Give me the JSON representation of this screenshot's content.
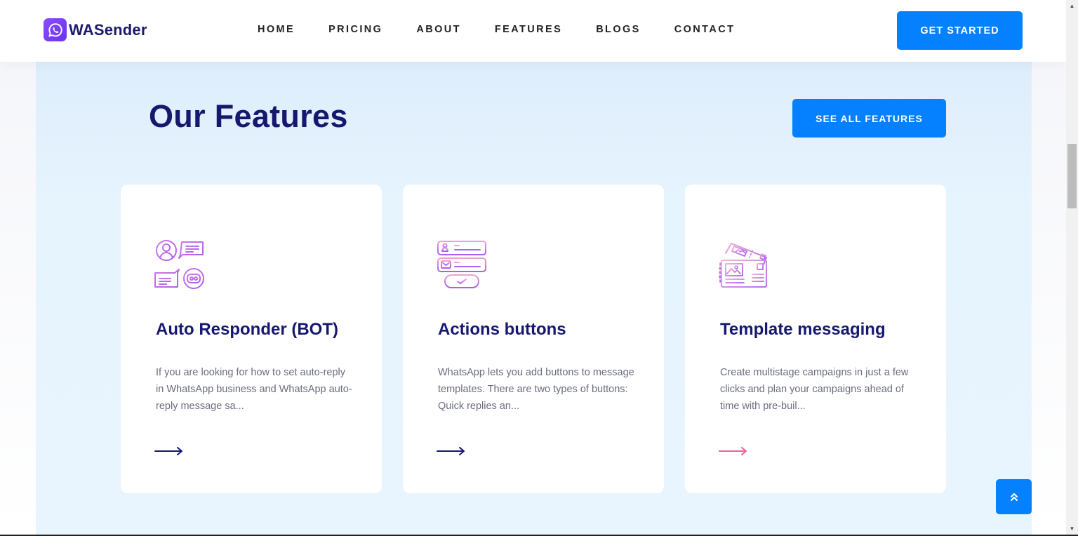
{
  "brand": {
    "name": "WASender",
    "icon": "whatsapp-icon"
  },
  "nav": {
    "items": [
      {
        "label": "HOME"
      },
      {
        "label": "PRICING"
      },
      {
        "label": "ABOUT"
      },
      {
        "label": "FEATURES"
      },
      {
        "label": "BLOGS"
      },
      {
        "label": "CONTACT"
      }
    ],
    "cta_label": "GET STARTED"
  },
  "features_section": {
    "title": "Our Features",
    "see_all_label": "SEE ALL FEATURES",
    "cards": [
      {
        "icon": "chat-bot-icon",
        "title": "Auto Responder (BOT)",
        "description": "If you are looking for how to set auto-reply in WhatsApp business and WhatsApp auto-reply message sa...",
        "arrow_icon": "arrow-right-icon"
      },
      {
        "icon": "action-buttons-icon",
        "title": "Actions buttons",
        "description": "WhatsApp lets you add buttons to message templates. There are two types of buttons: Quick replies an...",
        "arrow_icon": "arrow-right-icon"
      },
      {
        "icon": "template-postcard-icon",
        "title": "Template messaging",
        "description": "Create multistage campaigns in just a few clicks and plan your campaigns ahead of time with pre-buil...",
        "arrow_icon": "arrow-right-icon"
      }
    ]
  },
  "colors": {
    "primary": "#0581ff",
    "heading": "#161870",
    "body_text": "#6a6c80",
    "icon_gradient_start": "#f0a0d0",
    "icon_gradient_end": "#b060f0",
    "arrow_default": "#161870",
    "arrow_active": "#f0609a",
    "section_bg": "#e8f5ff"
  },
  "scroll_top": {
    "icon": "double-chevron-up-icon"
  }
}
